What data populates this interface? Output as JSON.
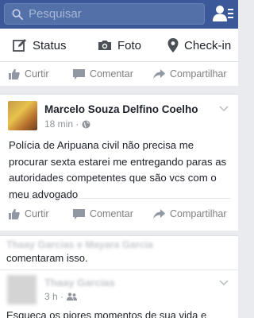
{
  "search": {
    "placeholder": "Pesquisar",
    "icon": "search-icon"
  },
  "header": {
    "friends_icon": "friend-requests-icon",
    "accent": "#3b5998"
  },
  "composer": {
    "status_label": "Status",
    "foto_label": "Foto",
    "checkin_label": "Check-in"
  },
  "actions": {
    "curtir": "Curtir",
    "comentar": "Comentar",
    "compartilhar": "Compartilhar"
  },
  "post": {
    "author": "Marcelo Souza Delfino Coelho",
    "time": "18 min ·",
    "text": "Polícia de Aripuana civil não precisa me procurar sexta estarei me entregando paras as autoridades competentes que são vcs com o meu advogado"
  },
  "activity": {
    "names": "Thaay Garcias e Mayara Garcia",
    "text": "comentaram isso.",
    "author": "Thaay Garcias",
    "time": "3 h ·",
    "bottom_text": "Esqueça os piores momentos de sua vida e"
  }
}
